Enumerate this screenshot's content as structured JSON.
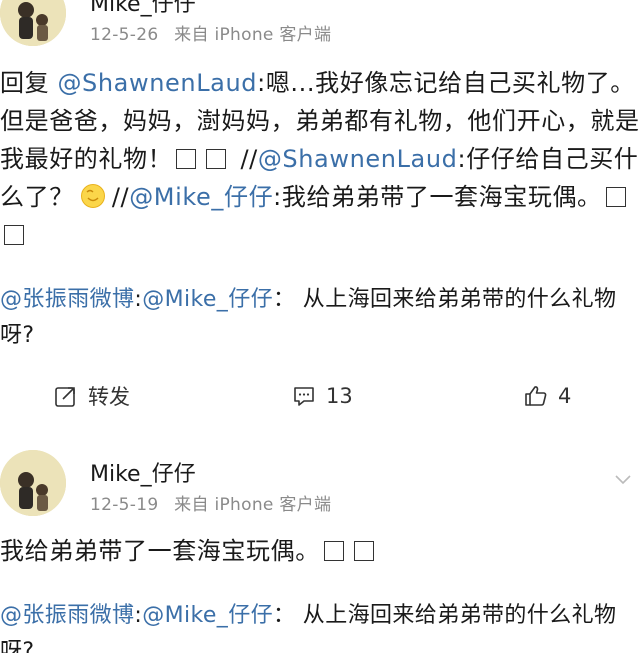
{
  "post1": {
    "username": "Mike_仔仔",
    "date": "12-5-26",
    "source": "来自 iPhone 客户端",
    "body": {
      "reply_prefix": "回复",
      "mention1": "@ShawnenLaud",
      "text1": ":嗯...我好像忘记给自己买礼物了。但是爸爸，妈妈，澍妈妈，弟弟都有礼物，他们开心，就是我最好的礼物！",
      "sep1": "//",
      "mention2": "@ShawnenLaud",
      "text2": ":仔仔给自己买什么了？",
      "sep2": "//",
      "mention3": "@Mike_仔仔",
      "text3": ":我给弟弟带了一套海宝玩偶。"
    },
    "quote": {
      "mention1": "@张振雨微博",
      "sep": ":",
      "mention2": "@Mike_仔仔",
      "text": "：  从上海回来给弟弟带的什么礼物呀?"
    },
    "actions": {
      "repost_label": "转发",
      "comment_count": "13",
      "like_count": "4"
    }
  },
  "post2": {
    "username": "Mike_仔仔",
    "date": "12-5-19",
    "source": "来自 iPhone 客户端",
    "body": {
      "text": "我给弟弟带了一套海宝玩偶。"
    },
    "quote": {
      "mention1": "@张振雨微博",
      "sep": ":",
      "mention2": "@Mike_仔仔",
      "text": "：  从上海回来给弟弟带的什么礼物呀?"
    }
  }
}
